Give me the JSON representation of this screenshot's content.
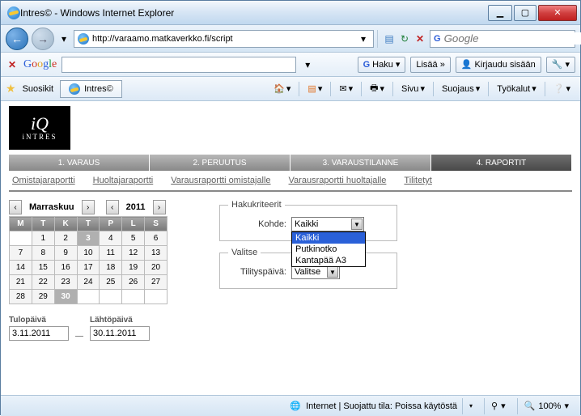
{
  "window": {
    "title": "Intres© - Windows Internet Explorer"
  },
  "nav": {
    "url": "http://varaamo.matkaverkko.fi/script",
    "search_placeholder": "Google"
  },
  "googlebar": {
    "haku": "Haku",
    "lisaa": "Lisää »",
    "kirjaudu": "Kirjaudu sisään"
  },
  "favrow": {
    "fav": "Suosikit",
    "tab": "Intres©",
    "menu_sivu": "Sivu",
    "menu_suojaus": "Suojaus",
    "menu_tyokalut": "Työkalut"
  },
  "app": {
    "logo_name": "iNTRES",
    "tabs": [
      "1. VARAUS",
      "2. PERUUTUS",
      "3. VARAUSTILANNE",
      "4. RAPORTIT"
    ],
    "active_tab": 3,
    "subtabs": [
      "Omistajaraportti",
      "Huoltajaraportti",
      "Varausraportti omistajalle",
      "Varausraportti huoltajalle",
      "Tilitetyt"
    ]
  },
  "calendar": {
    "month": "Marraskuu",
    "year": "2011",
    "dow": [
      "M",
      "T",
      "K",
      "T",
      "P",
      "L",
      "S"
    ],
    "weeks": [
      [
        "",
        1,
        2,
        3,
        4,
        5,
        6
      ],
      [
        7,
        8,
        9,
        10,
        11,
        12,
        13
      ],
      [
        14,
        15,
        16,
        17,
        18,
        19,
        20
      ],
      [
        21,
        22,
        23,
        24,
        25,
        26,
        27
      ],
      [
        28,
        29,
        30,
        "",
        "",
        "",
        ""
      ]
    ],
    "selected": [
      3,
      30
    ],
    "tulo_label": "Tulopäivä",
    "tulo_value": "3.11.2011",
    "lahto_label": "Lähtöpäivä",
    "lahto_value": "30.11.2011"
  },
  "criteria": {
    "legend1": "Hakukriteerit",
    "kohde_label": "Kohde:",
    "kohde_value": "Kaikki",
    "kohde_options": [
      "Kaikki",
      "Putkinotko",
      "Kantapää A3"
    ],
    "legend2": "Valitse",
    "tilitys_label": "Tilityspäivä:",
    "tilitys_value": "Valitse"
  },
  "status": {
    "text": "Internet | Suojattu tila: Poissa käytöstä",
    "zoom": "100%"
  }
}
